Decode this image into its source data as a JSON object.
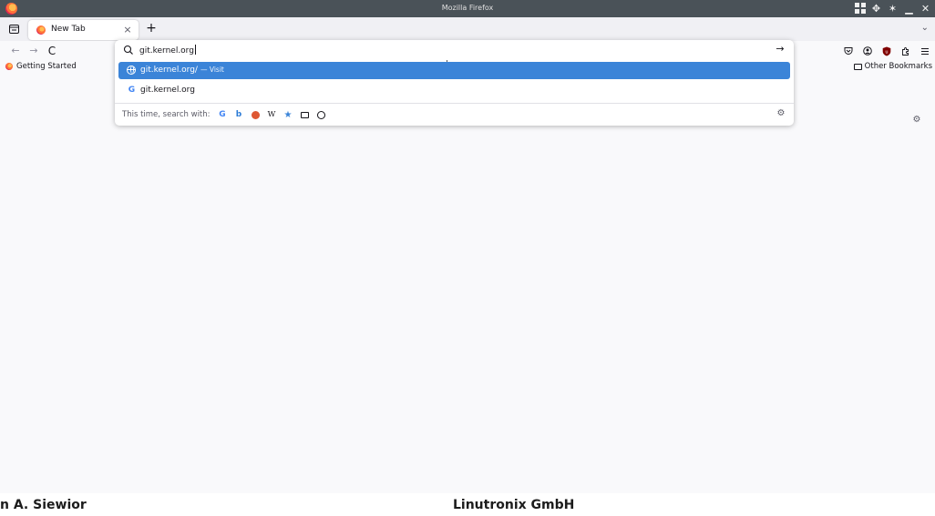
{
  "window": {
    "title": "Mozilla Firefox",
    "controls": [
      "tile-icon",
      "move-icon",
      "pin-icon",
      "minimize-icon",
      "maximize-icon"
    ]
  },
  "tabs": [
    {
      "label": "New Tab",
      "close": "×",
      "active": true
    }
  ],
  "tabstrip": {
    "new_tab": "+",
    "overflow": "⌄"
  },
  "navbar": {
    "back": "←",
    "forward": "→",
    "reload": "C",
    "right_tools": [
      "pocket-icon",
      "account-icon",
      "ublock-icon",
      "extensions-icon",
      "menu-icon"
    ]
  },
  "urlbar": {
    "value": "git.kernel.org",
    "go": "→",
    "results": [
      {
        "title": "git.kernel.org/",
        "action": "— Visit",
        "icon": "globe-icon",
        "selected": true
      },
      {
        "title": "git.kernel.org",
        "action": "",
        "icon": "google-icon",
        "selected": false
      }
    ],
    "oneoff_label": "This time, search with:",
    "engines": [
      "google-icon",
      "bing-icon",
      "duckduckgo-icon",
      "wikipedia-icon",
      "bookmarks-icon",
      "tabs-icon",
      "history-icon"
    ],
    "engine_glyphs": {
      "google": "G",
      "bing": "b",
      "wikipedia": "W",
      "bookmarks": "★"
    }
  },
  "bookmarks": {
    "items": [
      {
        "label": "Getting Started"
      }
    ],
    "other": "Other Bookmarks"
  },
  "footer": {
    "left": "n A. Siewior",
    "center": "Linutronix GmbH"
  },
  "colors": {
    "selected_result": "#3b84d8",
    "titlebar": "#4a5258",
    "tabstrip": "#f0f0f4"
  }
}
